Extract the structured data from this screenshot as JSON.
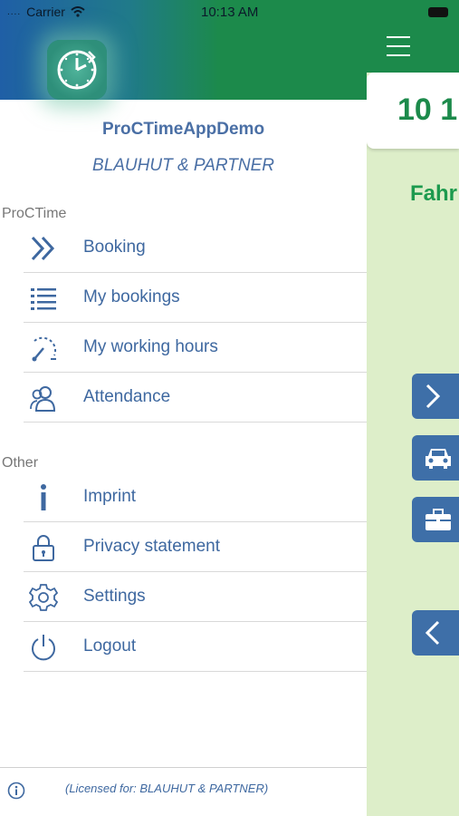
{
  "status_bar": {
    "carrier": "Carrier",
    "time": "10:13 AM"
  },
  "drawer": {
    "app_name": "ProCTimeAppDemo",
    "company": "BLAUHUT & PARTNER",
    "sections": [
      {
        "label": "ProCTime",
        "items": [
          {
            "label": "Booking",
            "icon": "double-chevron-right-icon"
          },
          {
            "label": "My bookings",
            "icon": "list-icon"
          },
          {
            "label": "My working hours",
            "icon": "working-hours-icon"
          },
          {
            "label": "Attendance",
            "icon": "people-icon"
          }
        ]
      },
      {
        "label": "Other",
        "items": [
          {
            "label": "Imprint",
            "icon": "info-icon"
          },
          {
            "label": "Privacy statement",
            "icon": "lock-icon"
          },
          {
            "label": "Settings",
            "icon": "gear-icon"
          },
          {
            "label": "Logout",
            "icon": "power-icon"
          }
        ]
      }
    ],
    "footer": {
      "license_text": "(Licensed for: BLAUHUT & PARTNER)"
    }
  },
  "main_screen": {
    "card_text": "10 1",
    "heading_text": "Fahr"
  },
  "colors": {
    "accent_blue": "#3e68a0",
    "brand_green": "#1c8a4b",
    "main_background": "#ddeec9",
    "button_blue": "#3e6fa8"
  }
}
